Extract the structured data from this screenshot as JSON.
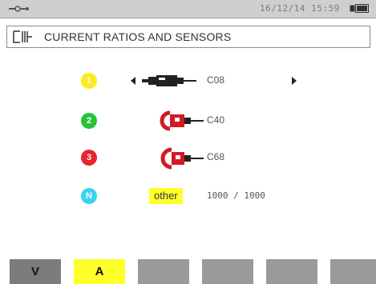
{
  "status": {
    "datetime": "16/12/14  15:59"
  },
  "title": {
    "text": "CURRENT RATIOS AND SENSORS"
  },
  "channels": [
    {
      "badge": "1",
      "color": "#ffea1e",
      "sensor_icon": "clamp-c-icon",
      "sensor": "C08"
    },
    {
      "badge": "2",
      "color": "#27c33b",
      "sensor_icon": "clamp-c-icon",
      "sensor": "C40"
    },
    {
      "badge": "3",
      "color": "#e8242c",
      "sensor_icon": "clamp-c-icon",
      "sensor": "C68"
    },
    {
      "badge": "N",
      "color": "#38d4f0",
      "sensor": "other",
      "ratio": "1000  /  1000"
    }
  ],
  "tabs": [
    {
      "label": "V"
    },
    {
      "label": "A"
    },
    {
      "label": ""
    },
    {
      "label": ""
    },
    {
      "label": ""
    },
    {
      "label": ""
    },
    {
      "label": ""
    }
  ],
  "colors": {
    "active_tab": "#ffff2a",
    "tab": "#9a9a9a"
  }
}
